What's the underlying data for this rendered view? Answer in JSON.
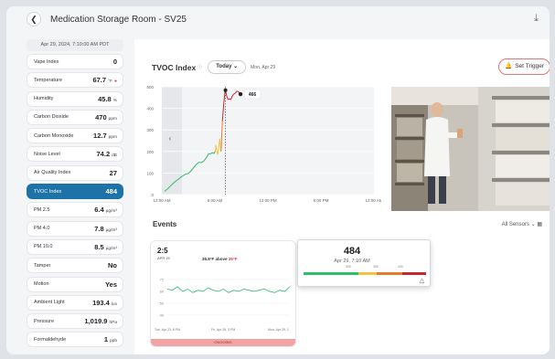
{
  "header": {
    "back_icon": "chevron-left-icon",
    "title": "Medication Storage Room - SV25",
    "download_icon": "download-icon"
  },
  "sidebar": {
    "timestamp": "Apr 29, 2024, 7:10:00 AM PDT",
    "metrics": [
      {
        "label": "Vape Index",
        "value": "0",
        "unit": ""
      },
      {
        "label": "Temperature",
        "value": "67.7",
        "unit": "°F",
        "alert": "●"
      },
      {
        "label": "Humidity",
        "value": "45.8",
        "unit": "%"
      },
      {
        "label": "Carbon Dioxide",
        "value": "470",
        "unit": "ppm"
      },
      {
        "label": "Carbon Monoxide",
        "value": "12.7",
        "unit": "ppm"
      },
      {
        "label": "Noise Level",
        "value": "74.2",
        "unit": "dB"
      },
      {
        "label": "Air Quality Index",
        "value": "27",
        "unit": ""
      },
      {
        "label": "TVOC Index",
        "value": "484",
        "unit": "",
        "active": true
      },
      {
        "label": "PM 2.5",
        "value": "6.4",
        "unit": "µg/m³"
      },
      {
        "label": "PM 4.0",
        "value": "7.8",
        "unit": "µg/m³"
      },
      {
        "label": "PM 10.0",
        "value": "8.5",
        "unit": "µg/m³"
      },
      {
        "label": "Tamper",
        "value": "No",
        "unit": ""
      },
      {
        "label": "Motion",
        "value": "Yes",
        "unit": ""
      },
      {
        "label": "Ambient Light",
        "value": "193.4",
        "unit": "lux"
      },
      {
        "label": "Pressure",
        "value": "1,019.9",
        "unit": "hPa"
      },
      {
        "label": "Formaldehyde",
        "value": "1",
        "unit": "ppb"
      }
    ]
  },
  "chart_header": {
    "title": "TVOC Index",
    "range_button": "Today",
    "date": "Mon, Apr 29",
    "trigger_button": "Set Trigger"
  },
  "chart_data": {
    "type": "line",
    "y_ticks": [
      "500",
      "400",
      "300",
      "200",
      "100",
      "0"
    ],
    "x_ticks": [
      "12:00 AM",
      "6:00 AM",
      "12:00 PM",
      "6:00 PM",
      "12:00 AM"
    ],
    "ylim": [
      0,
      500
    ],
    "xlim": [
      0,
      24
    ],
    "x": [
      0.3,
      0.7,
      1.1,
      1.5,
      1.9,
      2.3,
      2.7,
      3.0,
      3.3,
      3.6,
      3.9,
      4.2,
      4.5,
      4.8,
      5.1,
      5.3,
      5.5,
      5.7,
      5.9,
      6.0,
      6.05,
      6.1,
      6.3,
      6.4,
      6.55,
      6.7,
      6.85,
      7.0,
      7.15,
      7.2,
      7.35,
      7.5,
      7.65,
      7.8,
      7.95,
      8.1,
      8.3,
      8.5,
      8.7,
      8.9
    ],
    "y": [
      15,
      28,
      45,
      60,
      72,
      85,
      95,
      98,
      110,
      125,
      140,
      150,
      148,
      158,
      175,
      190,
      188,
      195,
      190,
      200,
      195,
      230,
      185,
      205,
      260,
      200,
      340,
      420,
      480,
      484,
      455,
      440,
      445,
      440,
      455,
      465,
      470,
      480,
      476,
      466
    ],
    "threshold_colors": [
      {
        "max": 200,
        "color": "#2ebd6b"
      },
      {
        "max": 300,
        "color": "#f2c53d"
      },
      {
        "max": 400,
        "color": "#e87a2e"
      },
      {
        "max": 500,
        "color": "#c8262e"
      }
    ],
    "peak_label": "466",
    "cursor_x": 7.2,
    "tooltip": {
      "value": "484",
      "time": "Apr 29, 7:10 AM",
      "scale_labels": [
        "300",
        "360",
        "440"
      ],
      "warning_icon": "warning-triangle-icon"
    }
  },
  "events": {
    "title": "Events",
    "filter_label": "All Sensors",
    "filter_icon": "calendar-icon",
    "card": {
      "time": "2:5",
      "subtitle": "APR 29",
      "threshold_text": "35.8°F above",
      "threshold_value": "35°F",
      "x_ticks": [
        "Tue, Apr 23, 8 PM",
        "Fri, Apr 26, 3 PM",
        "Mon, Apr 29, 1"
      ],
      "y_ticks": [
        "70",
        "60",
        "50",
        "40"
      ],
      "series": [
        62,
        61,
        64,
        60,
        62,
        59,
        61,
        60,
        63,
        61,
        60,
        62,
        59,
        61,
        60,
        62,
        61,
        60,
        61,
        62,
        60,
        59,
        61,
        60,
        64
      ],
      "status": "ONGOING"
    }
  },
  "colors": {
    "accent": "#1d73a8",
    "alert": "#d23b3b",
    "line": "#2ebd6b"
  }
}
